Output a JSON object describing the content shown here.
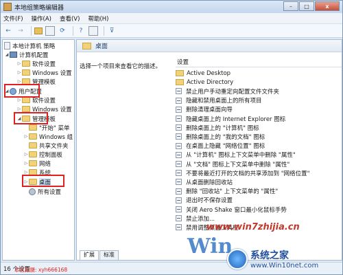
{
  "window": {
    "title": "本地组策略编辑器",
    "controls": {
      "min": "–",
      "max": "□",
      "close": "x"
    }
  },
  "menu": [
    "文件(F)",
    "操作(A)",
    "查看(V)",
    "帮助(H)"
  ],
  "toolbar": {
    "back": "←",
    "forward": "→",
    "refresh": "⟳",
    "info": "?",
    "filter": "⊽"
  },
  "tree": {
    "root": "本地计算机 策略",
    "computer_config": "计算机配置",
    "c_software": "软件设置",
    "c_windows": "Windows 设置",
    "c_admin": "管理模板",
    "user_config": "用户配置",
    "u_software": "软件设置",
    "u_windows": "Windows 设置",
    "u_admin": "管理模板",
    "start_menu": "\"开始\" 菜单",
    "windows_comp": "Windows 组",
    "shared_folder": "共享文件夹",
    "control_panel": "控制面板",
    "network": "网络",
    "system": "系统",
    "desktop": "桌面",
    "all_settings": "所有设置"
  },
  "right_pane": {
    "header": "桌面",
    "description": "选择一个项目来查看它的描述。",
    "column": "设置",
    "items": [
      {
        "type": "folder",
        "label": "Active Desktop"
      },
      {
        "type": "folder",
        "label": "Active Directory"
      },
      {
        "type": "policy",
        "label": "禁止用户手动重定向配置文件文件夹"
      },
      {
        "type": "policy",
        "label": "隐藏和禁用桌面上的所有项目"
      },
      {
        "type": "policy",
        "label": "删除清理桌面向导"
      },
      {
        "type": "policy",
        "label": "隐藏桌面上的 Internet Explorer 图标"
      },
      {
        "type": "policy",
        "label": "删除桌面上的 \"计算机\" 图标"
      },
      {
        "type": "policy",
        "label": "删除桌面上的 \"我的文档\" 图标"
      },
      {
        "type": "policy",
        "label": "在桌面上隐藏 \"网络位置\" 图标"
      },
      {
        "type": "policy",
        "label": "从 \"计算机\" 图标上下文菜单中删除 \"属性\""
      },
      {
        "type": "policy",
        "label": "从 \"文档\" 图标上下文菜单中删除 \"属性\""
      },
      {
        "type": "policy",
        "label": "不要将最近打开的文档的共享添加到 \"网络位置\""
      },
      {
        "type": "policy",
        "label": "从桌面删除回收站"
      },
      {
        "type": "policy",
        "label": "删除 \"回收站\" 上下文菜单的 \"属性\""
      },
      {
        "type": "policy",
        "label": "退出时不保存设置"
      },
      {
        "type": "policy",
        "label": "关闭 Aero Shake 窗口最小化鼠标手势"
      },
      {
        "type": "policy",
        "label": "禁止添加..."
      },
      {
        "type": "policy",
        "label": "禁用调整桌面工具栏"
      }
    ]
  },
  "tabs": [
    "扩展",
    "标准"
  ],
  "status": "16 个设置",
  "watermark": {
    "url": "www.win7zhijia.cn",
    "win": "Win",
    "cn": "系统之家",
    "en": "www.Win10net.com",
    "user": "本区拍摄: xyh666168"
  },
  "colors": {
    "highlight_box": "#e02020",
    "title_bar": "#c5d7ee"
  }
}
